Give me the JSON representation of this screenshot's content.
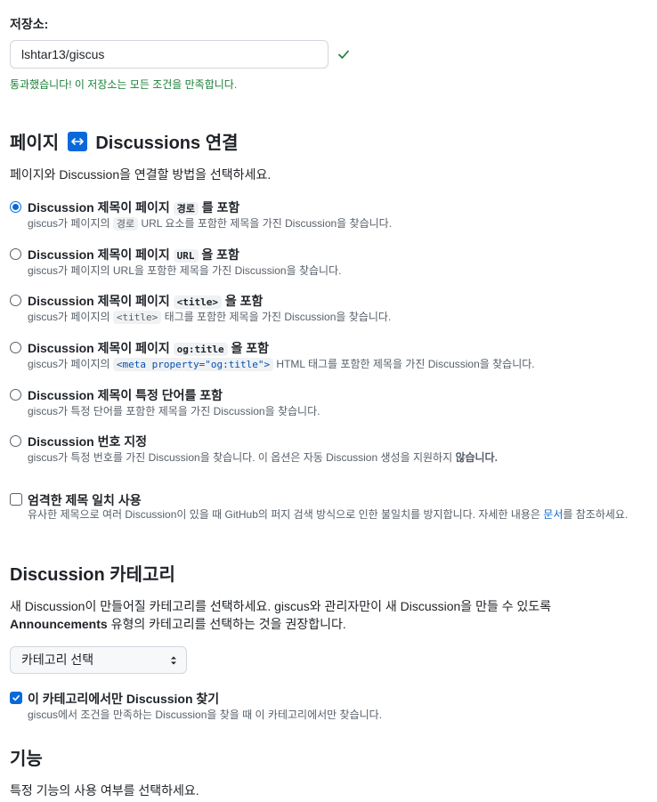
{
  "repo": {
    "label": "저장소:",
    "value": "lshtar13/giscus",
    "success": "통과했습니다! 이 저장소는 모든 조건을 만족합니다."
  },
  "mapping": {
    "heading_pre": "페이지",
    "heading_post": "Discussions 연결",
    "description": "페이지와 Discussion을 연결할 방법을 선택하세요.",
    "options": [
      {
        "title_pre": "Discussion 제목이 페이지 ",
        "code": "경로",
        "title_post": " 를 포함",
        "note_pre": "giscus가 페이지의 ",
        "note_code": "경로",
        "note_post": " URL 요소를 포함한 제목을 가진 Discussion을 찾습니다.",
        "checked": true
      },
      {
        "title_pre": "Discussion 제목이 페이지 ",
        "code": "URL",
        "title_post": " 을 포함",
        "note_pre": "giscus가 페이지의 URL을 포함한 제목을 가진 Discussion을 찾습니다.",
        "note_code": "",
        "note_post": "",
        "checked": false
      },
      {
        "title_pre": "Discussion 제목이 페이지 ",
        "code": "<title>",
        "title_post": " 을 포함",
        "note_pre": "giscus가 페이지의 ",
        "note_code": "<title>",
        "note_post": " 태그를 포함한 제목을 가진 Discussion을 찾습니다.",
        "checked": false
      },
      {
        "title_pre": "Discussion 제목이 페이지 ",
        "code": "og:title",
        "title_post": " 을 포함",
        "note_pre": "giscus가 페이지의 ",
        "note_code": "<meta property=\"og:title\">",
        "note_post": " HTML 태그를 포함한 제목을 가진 Discussion을 찾습니다.",
        "checked": false
      },
      {
        "title_pre": "Discussion 제목이 특정 단어를 포함",
        "code": "",
        "title_post": "",
        "note_pre": "giscus가 특정 단어를 포함한 제목을 가진 Discussion을 찾습니다.",
        "note_code": "",
        "note_post": "",
        "checked": false
      },
      {
        "title_pre": "Discussion 번호 지정",
        "code": "",
        "title_post": "",
        "note_pre": "giscus가 특정 번호를 가진 Discussion을 찾습니다. 이 옵션은 자동 Discussion 생성을 지원하지 ",
        "note_code": "",
        "note_post": "",
        "note_bold": "않습니다.",
        "checked": false
      }
    ],
    "strict": {
      "title": "엄격한 제목 일치 사용",
      "note_line1_pre": "유사한 제목으로 여러 Discussion이 있을 때 GitHub의 퍼지 검색 방식으로 인한 불일치를 방지합니다. 자세한 내용은 ",
      "note_link": "문서",
      "note_line1_post": "를 참조하",
      "note_line2": "세요.",
      "checked": false
    }
  },
  "category": {
    "heading": "Discussion 카테고리",
    "desc_line1": "새 Discussion이 만들어질 카테고리를 선택하세요. giscus와 관리자만이 새 Discussion을 만들 수 있도록",
    "desc_bold": "Announcements",
    "desc_line2": " 유형의 카테고리를 선택하는 것을 권장합니다.",
    "select_value": "카테고리 선택",
    "only_title": "이 카테고리에서만 Discussion 찾기",
    "only_note": "giscus에서 조건을 만족하는 Discussion을 찾을 때 이 카테고리에서만 찾습니다.",
    "only_checked": true
  },
  "features": {
    "heading": "기능",
    "description": "특정 기능의 사용 여부를 선택하세요."
  },
  "colors": {
    "accent": "#0969da",
    "success": "#1a7f37",
    "muted": "#57606a"
  },
  "icons": {
    "check": "check-icon",
    "connect": "arrow-both-icon",
    "select_caret": "chevron-up-down-icon"
  }
}
